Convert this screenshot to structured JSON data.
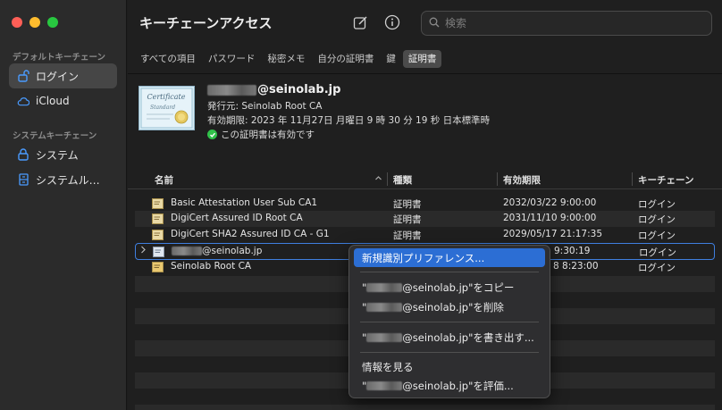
{
  "window": {
    "title": "キーチェーンアクセス",
    "controls": [
      "close",
      "minimize",
      "zoom"
    ]
  },
  "sidebar": {
    "default_section": "デフォルトキーチェーン",
    "default_items": [
      {
        "label": "ログイン",
        "icon": "unlock-icon",
        "selected": true
      },
      {
        "label": "iCloud",
        "icon": "cloud-icon",
        "selected": false
      }
    ],
    "system_section": "システムキーチェーン",
    "system_items": [
      {
        "label": "システム",
        "icon": "lock-icon"
      },
      {
        "label": "システムル…",
        "icon": "cabinet-icon"
      }
    ]
  },
  "toolbar": {
    "compose_icon": "compose-icon",
    "info_icon": "info-icon",
    "search_placeholder": "検索"
  },
  "tabs": [
    {
      "label": "すべての項目",
      "selected": false
    },
    {
      "label": "パスワード",
      "selected": false
    },
    {
      "label": "秘密メモ",
      "selected": false
    },
    {
      "label": "自分の証明書",
      "selected": false
    },
    {
      "label": "鍵",
      "selected": false
    },
    {
      "label": "証明書",
      "selected": true
    }
  ],
  "detail": {
    "name_suffix": "@seinolab.jp",
    "issuer": "発行元: Seinolab Root CA",
    "expiry": "有効期限: 2023 年 11月27日 月曜日 9 時 30 分 19 秒 日本標準時",
    "status": "この証明書は有効です",
    "image_lines": [
      "Certificate",
      "Standard"
    ]
  },
  "table": {
    "columns": [
      "名前",
      "種類",
      "有効期限",
      "キーチェーン"
    ],
    "rows": [
      {
        "name": "Basic Attestation User Sub CA1",
        "type": "証明書",
        "expiry": "2032/03/22 9:00:00",
        "keychain": "ログイン"
      },
      {
        "name": "DigiCert Assured ID Root CA",
        "type": "証明書",
        "expiry": "2031/11/10 9:00:00",
        "keychain": "ログイン"
      },
      {
        "name": "DigiCert SHA2 Assured ID CA - G1",
        "type": "証明書",
        "expiry": "2029/05/17 21:17:35",
        "keychain": "ログイン"
      },
      {
        "name": "@seinolab.jp",
        "type": "",
        "expiry": "9:30:19",
        "keychain": "ログイン"
      },
      {
        "name": "Seinolab Root CA",
        "type": "",
        "expiry": "8 8:23:00",
        "keychain": "ログイン"
      }
    ]
  },
  "context_menu": {
    "items": [
      {
        "label": "新規識別プリファレンス...",
        "active": true
      },
      {
        "label": "@seinolab.jp\"をコピー",
        "prefix": "\""
      },
      {
        "label": "@seinolab.jp\"を削除",
        "prefix": "\""
      },
      {
        "label": "@seinolab.jp\"を書き出す...",
        "prefix": "\""
      },
      {
        "label": "情報を見る"
      },
      {
        "label": "@seinolab.jp\"を評価...",
        "prefix": "\""
      }
    ]
  },
  "colors": {
    "accent": "#2c6ed4",
    "selection_outline": "#3f7fdf",
    "valid_green": "#31c24a"
  }
}
